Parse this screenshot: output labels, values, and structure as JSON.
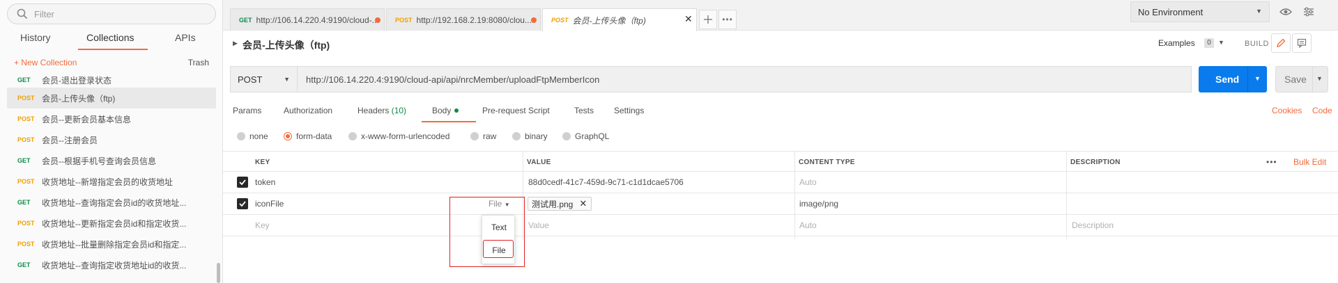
{
  "sidebar": {
    "filter_placeholder": "Filter",
    "tabs": [
      "History",
      "Collections",
      "APIs"
    ],
    "new_collection": "+ New Collection",
    "trash": "Trash",
    "requests": [
      {
        "method": "GET",
        "name": "会员-退出登录状态"
      },
      {
        "method": "POST",
        "name": "会员-上传头像（ftp)"
      },
      {
        "method": "POST",
        "name": "会员--更新会员基本信息"
      },
      {
        "method": "POST",
        "name": "会员--注册会员"
      },
      {
        "method": "GET",
        "name": "会员--根据手机号查询会员信息"
      },
      {
        "method": "POST",
        "name": "收货地址--新增指定会员的收货地址"
      },
      {
        "method": "GET",
        "name": "收货地址--查询指定会员id的收货地址..."
      },
      {
        "method": "POST",
        "name": "收货地址--更新指定会员id和指定收货..."
      },
      {
        "method": "POST",
        "name": "收货地址--批量删除指定会员id和指定..."
      },
      {
        "method": "GET",
        "name": "收货地址--查询指定收货地址id的收货..."
      }
    ]
  },
  "tabs": [
    {
      "method": "GET",
      "title": "http://106.14.220.4:9190/cloud-..."
    },
    {
      "method": "POST",
      "title": "http://192.168.2.19:8080/clou..."
    },
    {
      "method": "POST",
      "title": "会员-上传头像（ftp)"
    }
  ],
  "environment": "No Environment",
  "request": {
    "title": "会员-上传头像（ftp)",
    "examples_label": "Examples",
    "examples_count": "0",
    "build_label": "BUILD",
    "method": "POST",
    "url": "http://106.14.220.4:9190/cloud-api/api/nrcMember/uploadFtpMemberIcon",
    "send_label": "Send",
    "save_label": "Save"
  },
  "subtabs": {
    "params": "Params",
    "authorization": "Authorization",
    "headers": "Headers",
    "headers_count": "(10)",
    "body": "Body",
    "prerequest": "Pre-request Script",
    "tests": "Tests",
    "settings": "Settings",
    "cookies": "Cookies",
    "code": "Code"
  },
  "body_types": [
    "none",
    "form-data",
    "x-www-form-urlencoded",
    "raw",
    "binary",
    "GraphQL"
  ],
  "body_type_selected": "form-data",
  "table": {
    "headers": [
      "KEY",
      "VALUE",
      "CONTENT TYPE",
      "DESCRIPTION"
    ],
    "bulk_edit": "Bulk Edit",
    "rows": [
      {
        "key": "token",
        "value": "88d0cedf-41c7-459d-9c71-c1d1dcae5706",
        "content_type": "Auto"
      },
      {
        "key": "iconFile",
        "type_select": "File",
        "file": "测试用.png",
        "content_type": "image/png"
      }
    ],
    "placeholders": {
      "key": "Key",
      "value": "Value",
      "content_type": "Auto",
      "description": "Description"
    }
  },
  "dropdown": [
    "Text",
    "File"
  ],
  "colors": {
    "accent": "#f26b3a",
    "send": "#097bed",
    "get": "#0f8a4a",
    "post": "#f0a000"
  }
}
